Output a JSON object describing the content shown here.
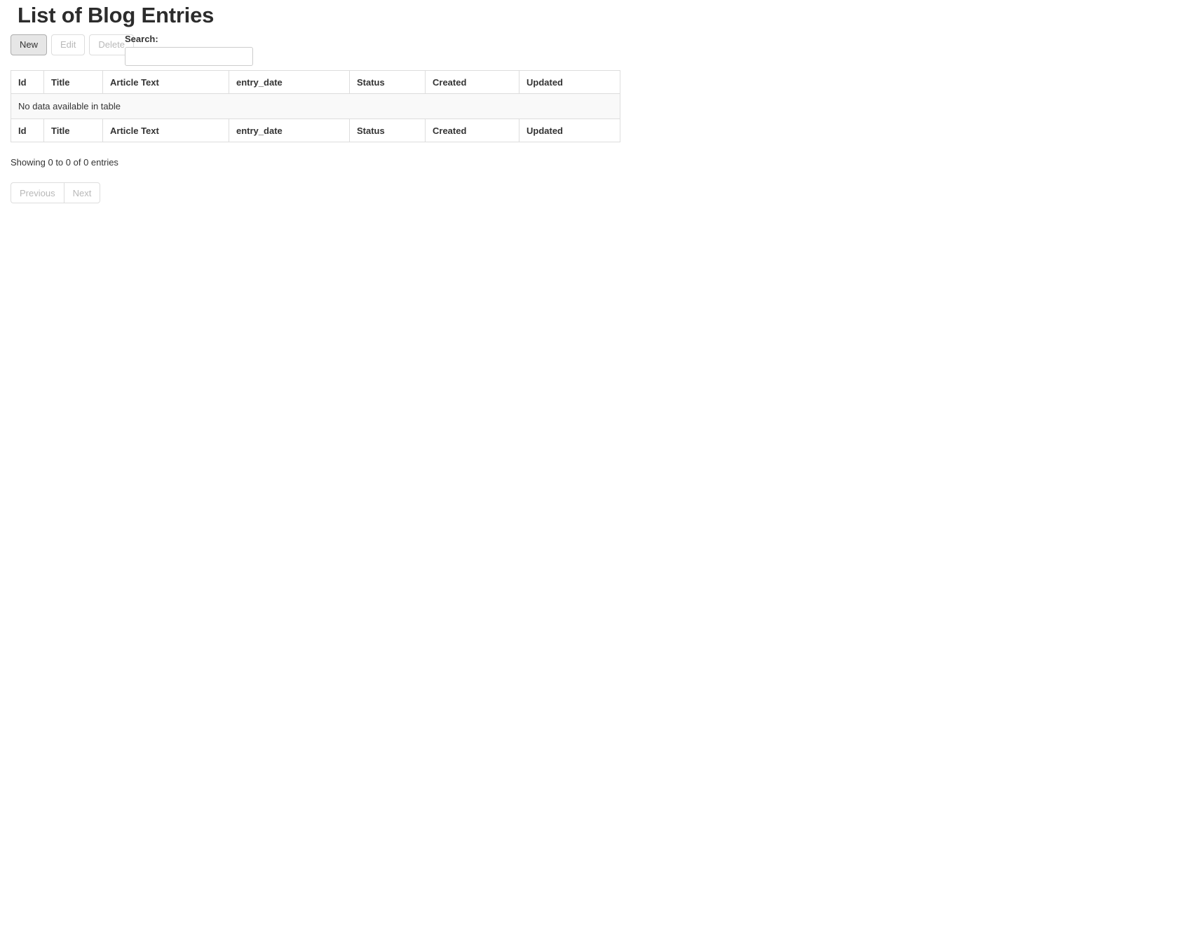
{
  "page": {
    "title": "List of Blog Entries"
  },
  "toolbar": {
    "new_label": "New",
    "edit_label": "Edit",
    "delete_label": "Delete"
  },
  "search": {
    "label": "Search:",
    "value": "",
    "placeholder": ""
  },
  "table": {
    "columns": [
      "Id",
      "Title",
      "Article Text",
      "entry_date",
      "Status",
      "Created",
      "Updated"
    ],
    "footer_columns": [
      "Id",
      "Title",
      "Article Text",
      "entry_date",
      "Status",
      "Created",
      "Updated"
    ],
    "empty_message": "No data available in table",
    "rows": []
  },
  "footer": {
    "info": "Showing 0 to 0 of 0 entries",
    "previous_label": "Previous",
    "next_label": "Next"
  },
  "colors": {
    "border": "#dddddd",
    "empty_row_bg": "#f9f9f9",
    "active_button_bg": "#e6e6e6",
    "disabled_text": "#b8b8b8"
  }
}
